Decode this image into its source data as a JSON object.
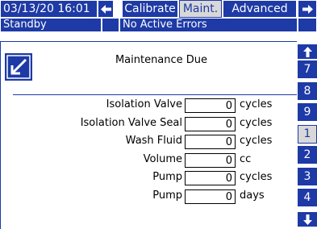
{
  "header": {
    "datetime": "03/13/20 16:01",
    "tabs": [
      {
        "label": "Calibrate"
      },
      {
        "label": "Maint."
      },
      {
        "label": "Advanced"
      }
    ],
    "active_tab": "Maint.",
    "left_arrow_icon": "left-arrow-icon",
    "right_arrow_icon": "right-arrow-icon"
  },
  "status": {
    "mode": "Standby",
    "errors": "No Active Errors"
  },
  "screen": {
    "icon": "wrench-edit-icon",
    "title": "Maintenance Due"
  },
  "rows": [
    {
      "label": "Isolation Valve",
      "value": "0",
      "unit": "cycles"
    },
    {
      "label": "Isolation Valve Seal",
      "value": "0",
      "unit": "cycles"
    },
    {
      "label": "Wash Fluid",
      "value": "0",
      "unit": "cycles"
    },
    {
      "label": "Volume",
      "value": "0",
      "unit": "cc"
    },
    {
      "label": "Pump",
      "value": "0",
      "unit": "cycles"
    },
    {
      "label": "Pump",
      "value": "0",
      "unit": "days"
    }
  ],
  "side_nav": {
    "up_icon": "up-arrow-icon",
    "down_icon": "down-arrow-icon",
    "pages": [
      "7",
      "8",
      "9",
      "1",
      "2",
      "3",
      "4"
    ],
    "active_page": "1"
  },
  "colors": {
    "accent": "#1d3aa6",
    "active_bg": "#d8d8d8"
  }
}
